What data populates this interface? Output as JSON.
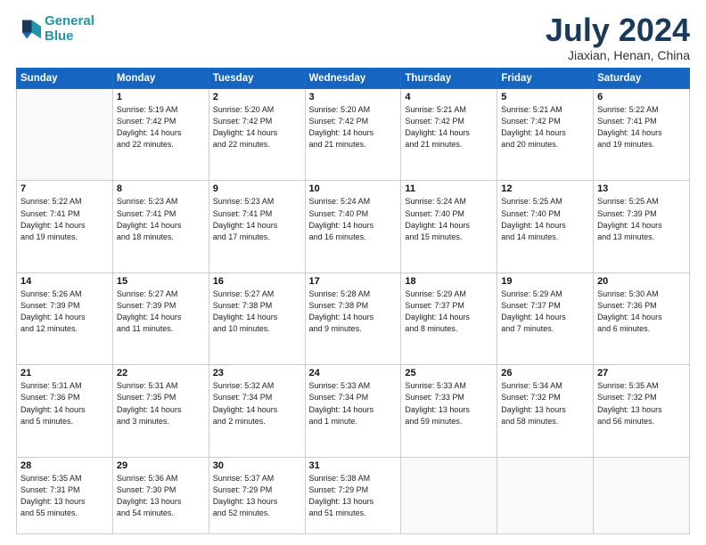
{
  "header": {
    "logo_line1": "General",
    "logo_line2": "Blue",
    "title": "July 2024",
    "location": "Jiaxian, Henan, China"
  },
  "weekdays": [
    "Sunday",
    "Monday",
    "Tuesday",
    "Wednesday",
    "Thursday",
    "Friday",
    "Saturday"
  ],
  "weeks": [
    [
      {
        "day": "",
        "info": ""
      },
      {
        "day": "1",
        "info": "Sunrise: 5:19 AM\nSunset: 7:42 PM\nDaylight: 14 hours\nand 22 minutes."
      },
      {
        "day": "2",
        "info": "Sunrise: 5:20 AM\nSunset: 7:42 PM\nDaylight: 14 hours\nand 22 minutes."
      },
      {
        "day": "3",
        "info": "Sunrise: 5:20 AM\nSunset: 7:42 PM\nDaylight: 14 hours\nand 21 minutes."
      },
      {
        "day": "4",
        "info": "Sunrise: 5:21 AM\nSunset: 7:42 PM\nDaylight: 14 hours\nand 21 minutes."
      },
      {
        "day": "5",
        "info": "Sunrise: 5:21 AM\nSunset: 7:42 PM\nDaylight: 14 hours\nand 20 minutes."
      },
      {
        "day": "6",
        "info": "Sunrise: 5:22 AM\nSunset: 7:41 PM\nDaylight: 14 hours\nand 19 minutes."
      }
    ],
    [
      {
        "day": "7",
        "info": "Sunrise: 5:22 AM\nSunset: 7:41 PM\nDaylight: 14 hours\nand 19 minutes."
      },
      {
        "day": "8",
        "info": "Sunrise: 5:23 AM\nSunset: 7:41 PM\nDaylight: 14 hours\nand 18 minutes."
      },
      {
        "day": "9",
        "info": "Sunrise: 5:23 AM\nSunset: 7:41 PM\nDaylight: 14 hours\nand 17 minutes."
      },
      {
        "day": "10",
        "info": "Sunrise: 5:24 AM\nSunset: 7:40 PM\nDaylight: 14 hours\nand 16 minutes."
      },
      {
        "day": "11",
        "info": "Sunrise: 5:24 AM\nSunset: 7:40 PM\nDaylight: 14 hours\nand 15 minutes."
      },
      {
        "day": "12",
        "info": "Sunrise: 5:25 AM\nSunset: 7:40 PM\nDaylight: 14 hours\nand 14 minutes."
      },
      {
        "day": "13",
        "info": "Sunrise: 5:25 AM\nSunset: 7:39 PM\nDaylight: 14 hours\nand 13 minutes."
      }
    ],
    [
      {
        "day": "14",
        "info": "Sunrise: 5:26 AM\nSunset: 7:39 PM\nDaylight: 14 hours\nand 12 minutes."
      },
      {
        "day": "15",
        "info": "Sunrise: 5:27 AM\nSunset: 7:39 PM\nDaylight: 14 hours\nand 11 minutes."
      },
      {
        "day": "16",
        "info": "Sunrise: 5:27 AM\nSunset: 7:38 PM\nDaylight: 14 hours\nand 10 minutes."
      },
      {
        "day": "17",
        "info": "Sunrise: 5:28 AM\nSunset: 7:38 PM\nDaylight: 14 hours\nand 9 minutes."
      },
      {
        "day": "18",
        "info": "Sunrise: 5:29 AM\nSunset: 7:37 PM\nDaylight: 14 hours\nand 8 minutes."
      },
      {
        "day": "19",
        "info": "Sunrise: 5:29 AM\nSunset: 7:37 PM\nDaylight: 14 hours\nand 7 minutes."
      },
      {
        "day": "20",
        "info": "Sunrise: 5:30 AM\nSunset: 7:36 PM\nDaylight: 14 hours\nand 6 minutes."
      }
    ],
    [
      {
        "day": "21",
        "info": "Sunrise: 5:31 AM\nSunset: 7:36 PM\nDaylight: 14 hours\nand 5 minutes."
      },
      {
        "day": "22",
        "info": "Sunrise: 5:31 AM\nSunset: 7:35 PM\nDaylight: 14 hours\nand 3 minutes."
      },
      {
        "day": "23",
        "info": "Sunrise: 5:32 AM\nSunset: 7:34 PM\nDaylight: 14 hours\nand 2 minutes."
      },
      {
        "day": "24",
        "info": "Sunrise: 5:33 AM\nSunset: 7:34 PM\nDaylight: 14 hours\nand 1 minute."
      },
      {
        "day": "25",
        "info": "Sunrise: 5:33 AM\nSunset: 7:33 PM\nDaylight: 13 hours\nand 59 minutes."
      },
      {
        "day": "26",
        "info": "Sunrise: 5:34 AM\nSunset: 7:32 PM\nDaylight: 13 hours\nand 58 minutes."
      },
      {
        "day": "27",
        "info": "Sunrise: 5:35 AM\nSunset: 7:32 PM\nDaylight: 13 hours\nand 56 minutes."
      }
    ],
    [
      {
        "day": "28",
        "info": "Sunrise: 5:35 AM\nSunset: 7:31 PM\nDaylight: 13 hours\nand 55 minutes."
      },
      {
        "day": "29",
        "info": "Sunrise: 5:36 AM\nSunset: 7:30 PM\nDaylight: 13 hours\nand 54 minutes."
      },
      {
        "day": "30",
        "info": "Sunrise: 5:37 AM\nSunset: 7:29 PM\nDaylight: 13 hours\nand 52 minutes."
      },
      {
        "day": "31",
        "info": "Sunrise: 5:38 AM\nSunset: 7:29 PM\nDaylight: 13 hours\nand 51 minutes."
      },
      {
        "day": "",
        "info": ""
      },
      {
        "day": "",
        "info": ""
      },
      {
        "day": "",
        "info": ""
      }
    ]
  ]
}
